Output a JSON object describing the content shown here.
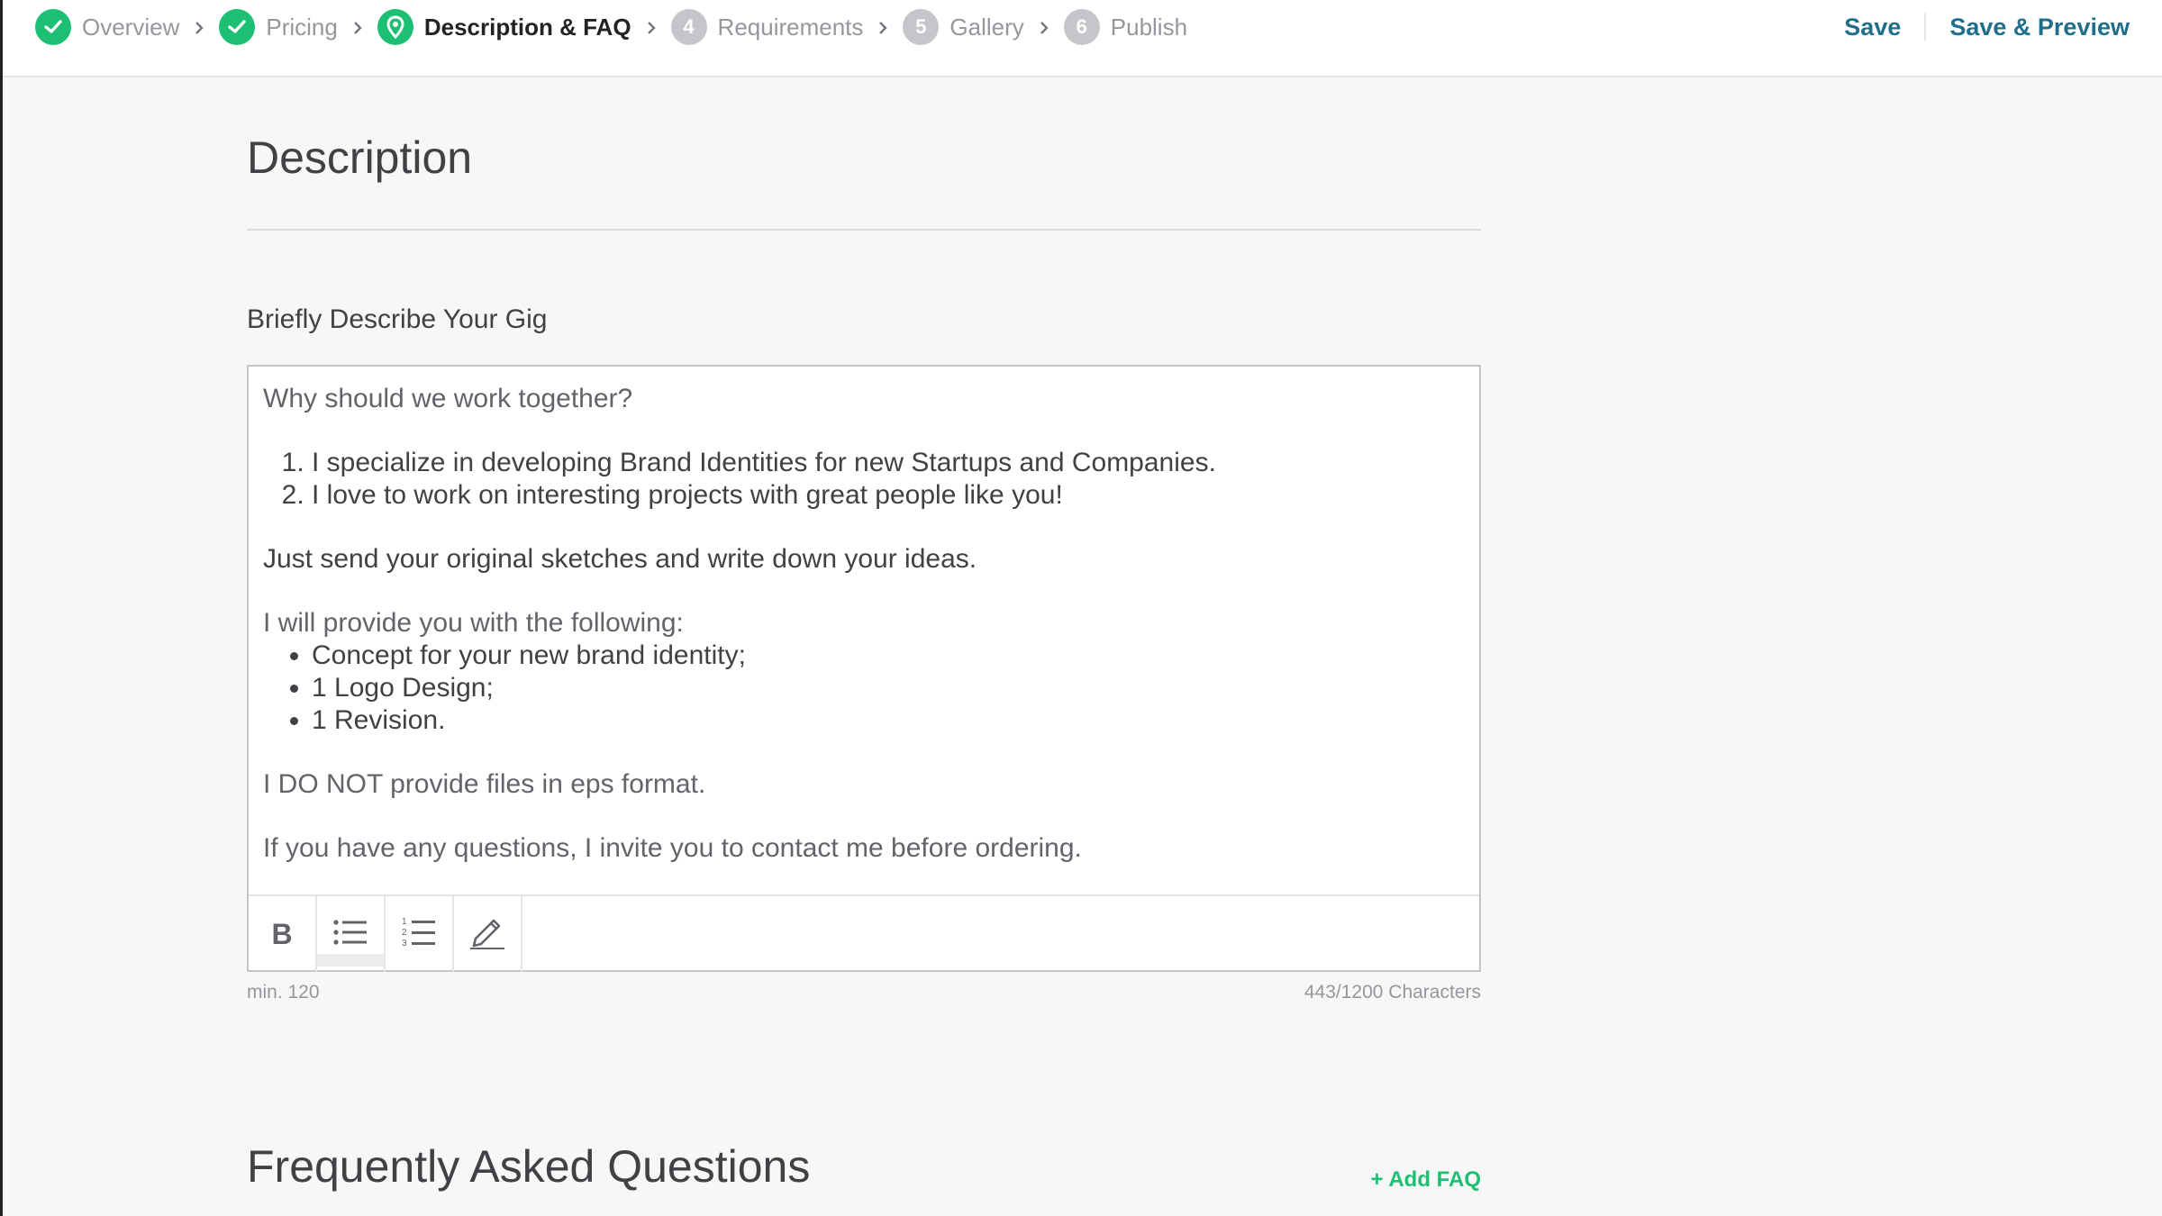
{
  "wizard": {
    "steps": [
      {
        "label": "Overview",
        "status": "done",
        "number": ""
      },
      {
        "label": "Pricing",
        "status": "done",
        "number": ""
      },
      {
        "label": "Description & FAQ",
        "status": "current",
        "number": ""
      },
      {
        "label": "Requirements",
        "status": "todo",
        "number": "4"
      },
      {
        "label": "Gallery",
        "status": "todo",
        "number": "5"
      },
      {
        "label": "Publish",
        "status": "todo",
        "number": "6"
      }
    ],
    "save_label": "Save",
    "save_preview_label": "Save & Preview"
  },
  "description": {
    "title": "Description",
    "field_label": "Briefly Describe Your Gig",
    "body": {
      "intro": "Why should we work together?",
      "reasons": [
        "I specialize in developing Brand Identities for new Startups and Companies.",
        "I love to work on interesting projects with great people like you!"
      ],
      "cta": "Just send your original sketches and write down your ideas.",
      "provide_intro": "I will provide you with the following:",
      "provides": [
        "Concept for your new brand identity;",
        "1 Logo Design;",
        "1 Revision."
      ],
      "notice": "I DO NOT provide files in eps format.",
      "closing": "If you have any questions, I invite you to contact me before ordering."
    },
    "toolbar": {
      "bold": "B"
    },
    "min_label": "min. 120",
    "char_count": "443/1200 Characters"
  },
  "faq": {
    "title": "Frequently Asked Questions",
    "add_label": "+ Add FAQ"
  },
  "colors": {
    "accent_green": "#1dbf73",
    "link_blue": "#1f6f8b",
    "pending_grey": "#c5c6c9"
  }
}
